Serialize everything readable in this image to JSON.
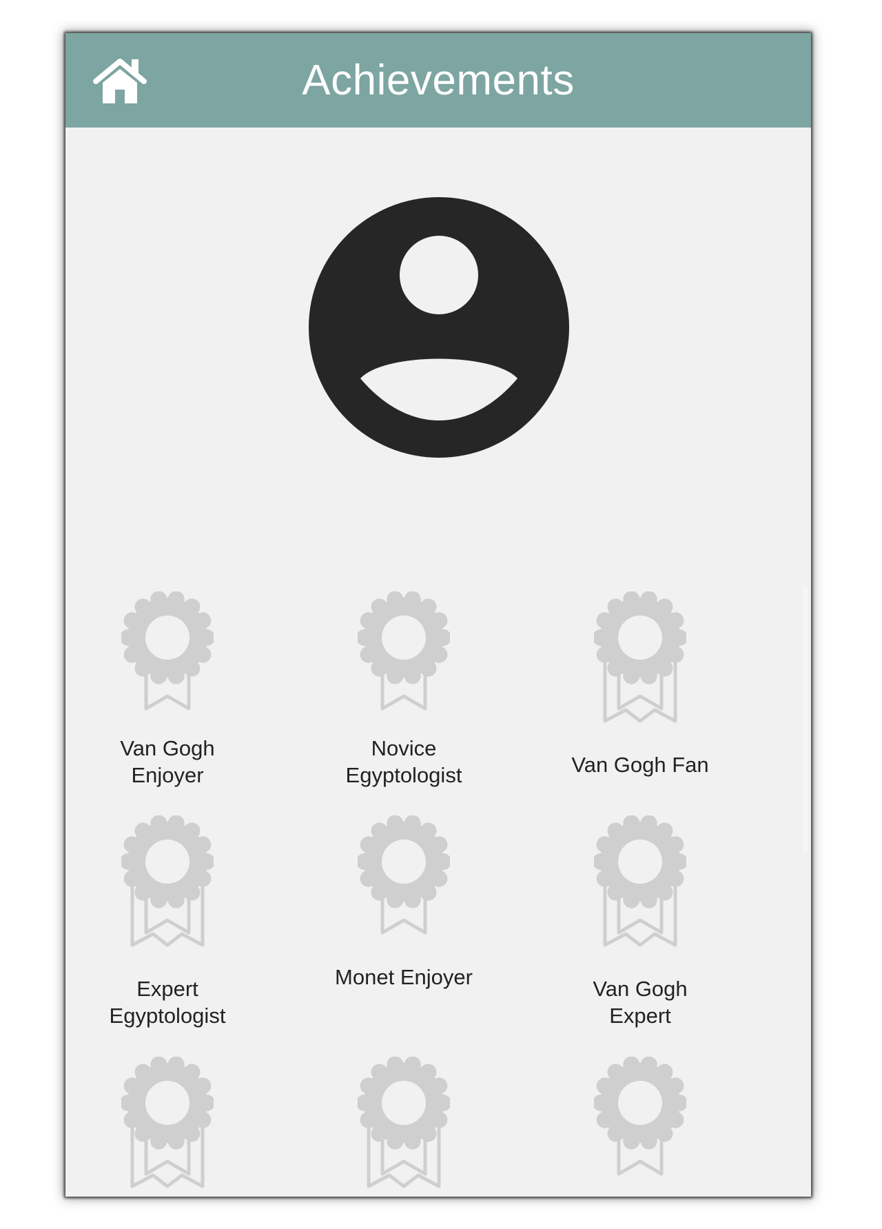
{
  "header": {
    "title": "Achievements",
    "home_icon": "home-icon",
    "background_color": "#7da5a1",
    "title_color": "#ffffff"
  },
  "profile": {
    "avatar_icon": "account-circle-icon",
    "avatar_color": "#262626"
  },
  "achievements": [
    {
      "line1": "Van Gogh",
      "line2": "Enjoyer",
      "icon": "award-medal-icon"
    },
    {
      "line1": "Novice",
      "line2": "Egyptologist",
      "icon": "award-medal-icon"
    },
    {
      "line1": "Van Gogh Fan",
      "line2": "",
      "icon": "award-medal-double-ribbon-icon"
    },
    {
      "line1": "Expert",
      "line2": "Egyptologist",
      "icon": "award-medal-double-ribbon-icon"
    },
    {
      "line1": "Monet Enjoyer",
      "line2": "",
      "icon": "award-medal-icon"
    },
    {
      "line1": "Van Gogh",
      "line2": "Expert",
      "icon": "award-medal-double-ribbon-icon"
    },
    {
      "line1": "",
      "line2": "",
      "icon": "award-medal-double-ribbon-icon"
    },
    {
      "line1": "",
      "line2": "",
      "icon": "award-medal-double-ribbon-icon"
    },
    {
      "line1": "",
      "line2": "",
      "icon": "award-medal-icon"
    }
  ],
  "colors": {
    "background": "#f1f1f1",
    "locked_badge": "#cfcfcf",
    "label_text": "#222222"
  }
}
